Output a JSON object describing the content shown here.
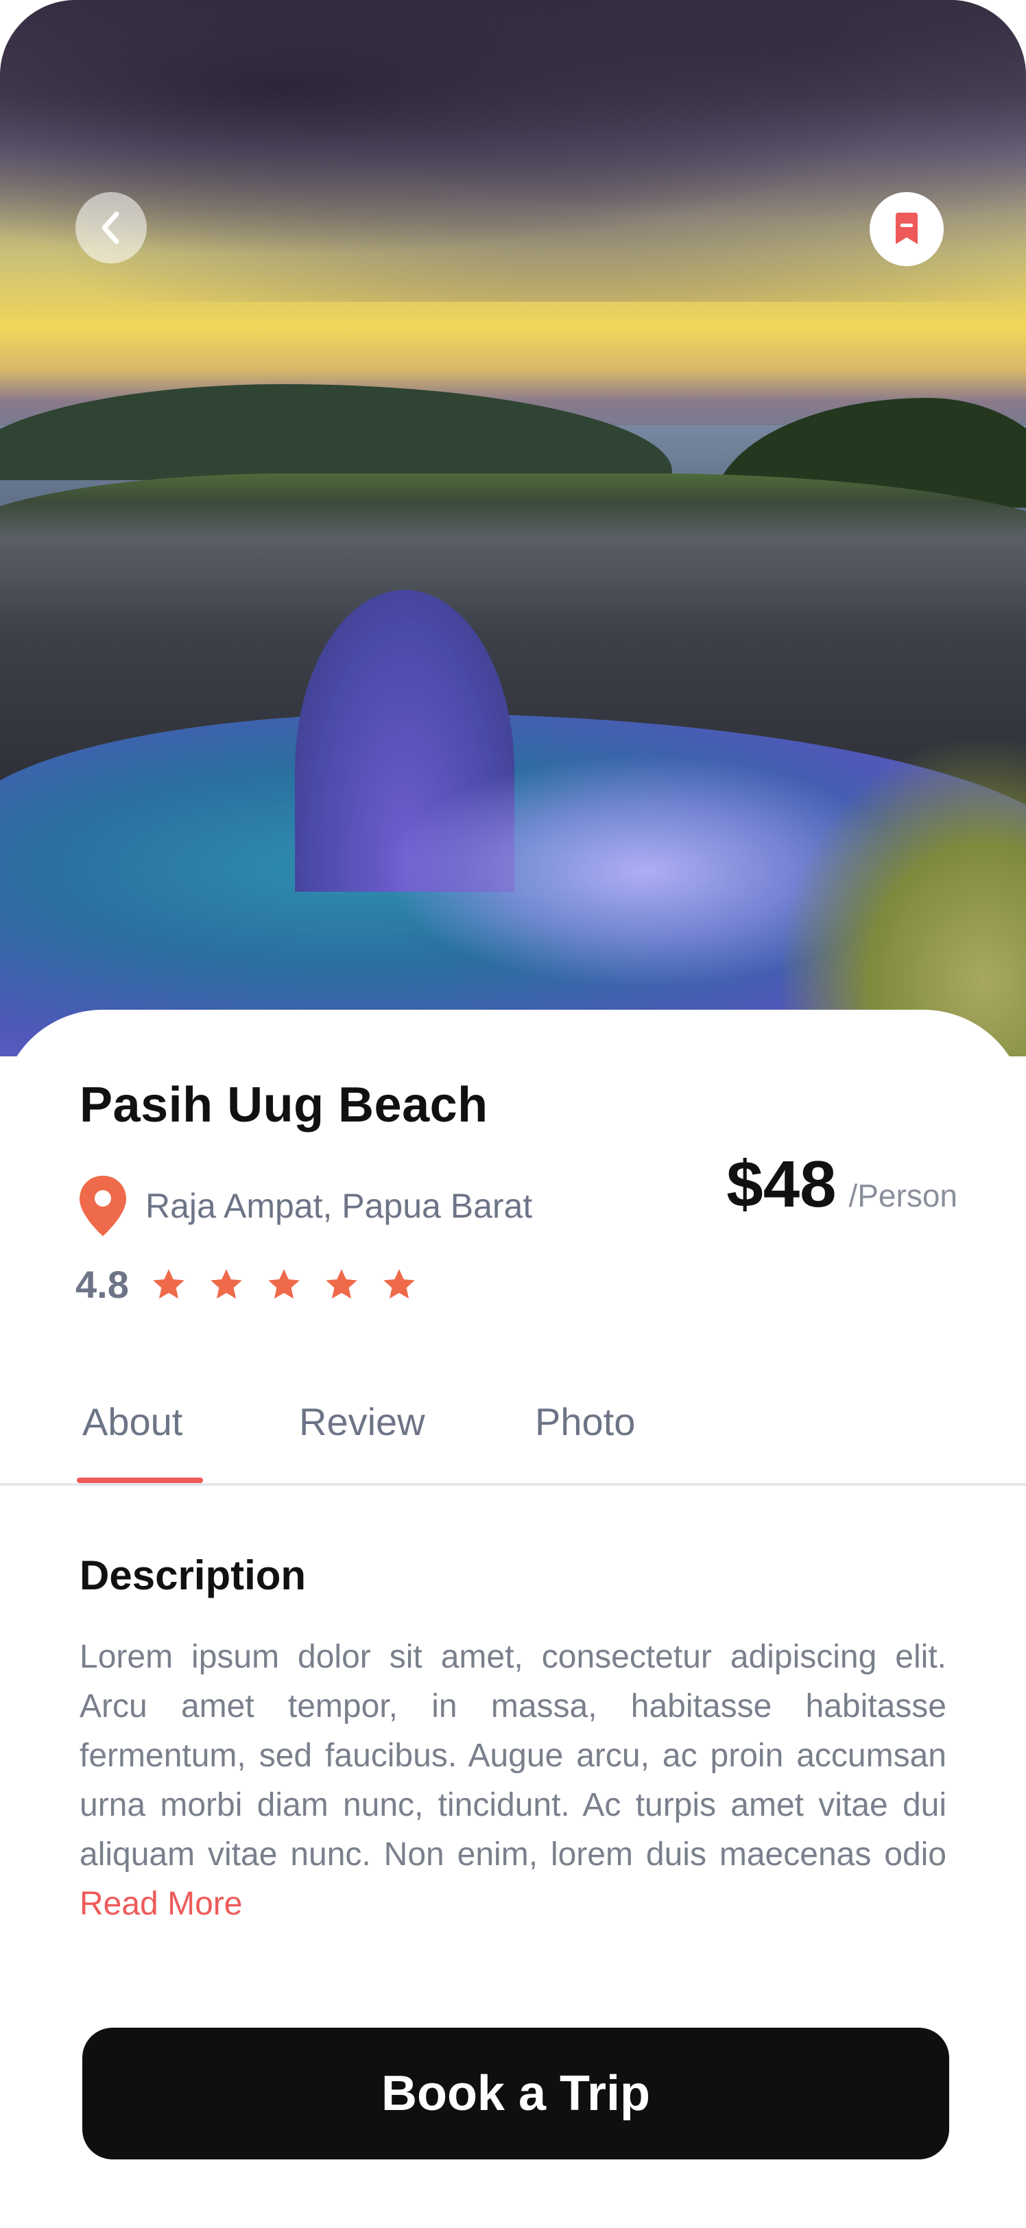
{
  "header": {
    "back_icon": "chevron-left-icon",
    "bookmark_icon": "bookmark-icon",
    "accent_color": "#ee5a5a"
  },
  "place": {
    "title": "Pasih Uug Beach",
    "location": "Raja Ampat, Papua Barat",
    "location_icon": "map-pin-icon",
    "price": "$48",
    "price_unit": "/Person",
    "rating": "4.8",
    "stars": 5
  },
  "tabs": [
    {
      "label": "About",
      "active": true
    },
    {
      "label": "Review",
      "active": false
    },
    {
      "label": "Photo",
      "active": false
    }
  ],
  "description": {
    "heading": "Description",
    "body": "Lorem ipsum dolor sit amet, consectetur adipiscing elit. Arcu amet tempor, in massa, habitasse habitasse fermentum, sed faucibus. Augue arcu, ac proin accumsan urna morbi diam nunc, tincidunt. Ac turpis amet vitae dui aliquam vitae nunc. Non enim, lorem duis maecenas odio",
    "read_more": "Read More"
  },
  "cta": {
    "label": "Book a Trip"
  }
}
